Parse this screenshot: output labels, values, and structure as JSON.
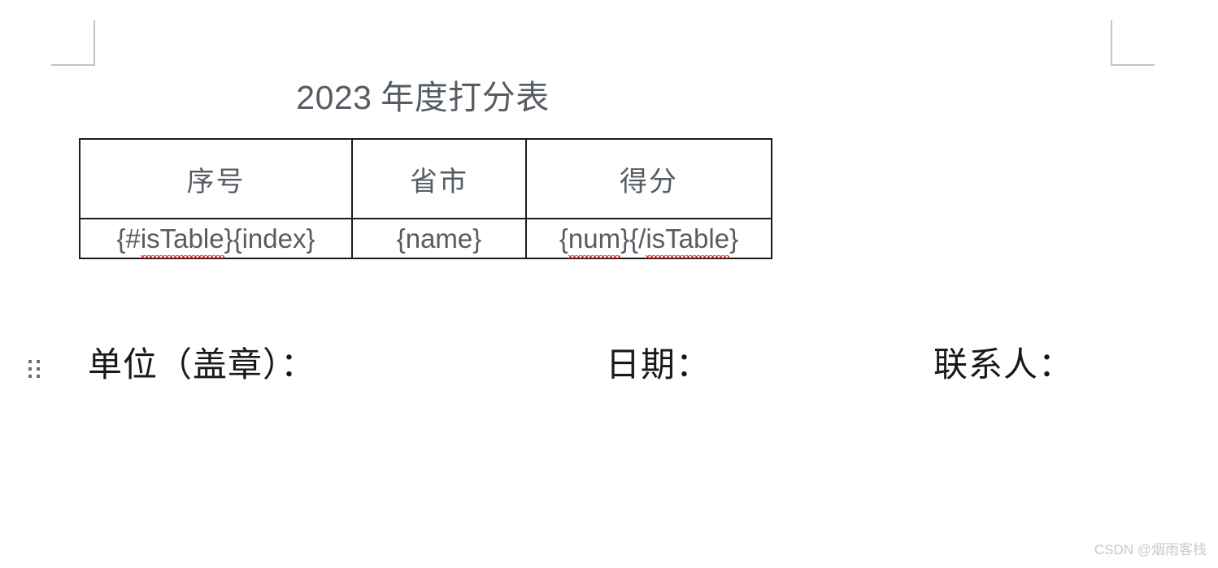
{
  "document": {
    "title_year": "2023",
    "title_text": " 年度打分表"
  },
  "table": {
    "headers": [
      "序号",
      "省市",
      "得分"
    ],
    "row": {
      "cell_1": {
        "prefix": "{#",
        "tag": "isTable",
        "suffix": "}{index}"
      },
      "cell_2": {
        "text": "{name}"
      },
      "cell_3": {
        "open": "{",
        "tag_num": "num",
        "middle": "}{/",
        "tag_table": "isTable",
        "close": "}"
      }
    }
  },
  "footer": {
    "unit_label": "单位（盖章）：",
    "date_label": "日期：",
    "contact_label": "联系人："
  },
  "watermark": {
    "text": "CSDN @烟雨客栈"
  },
  "colors": {
    "body_text": "#565c63",
    "footer_text": "#17181c",
    "table_border": "#1b1b1b",
    "spellcheck_underline": "#e02a26",
    "crop_mark": "#c3c3c3",
    "watermark": "#c9c9cc"
  }
}
